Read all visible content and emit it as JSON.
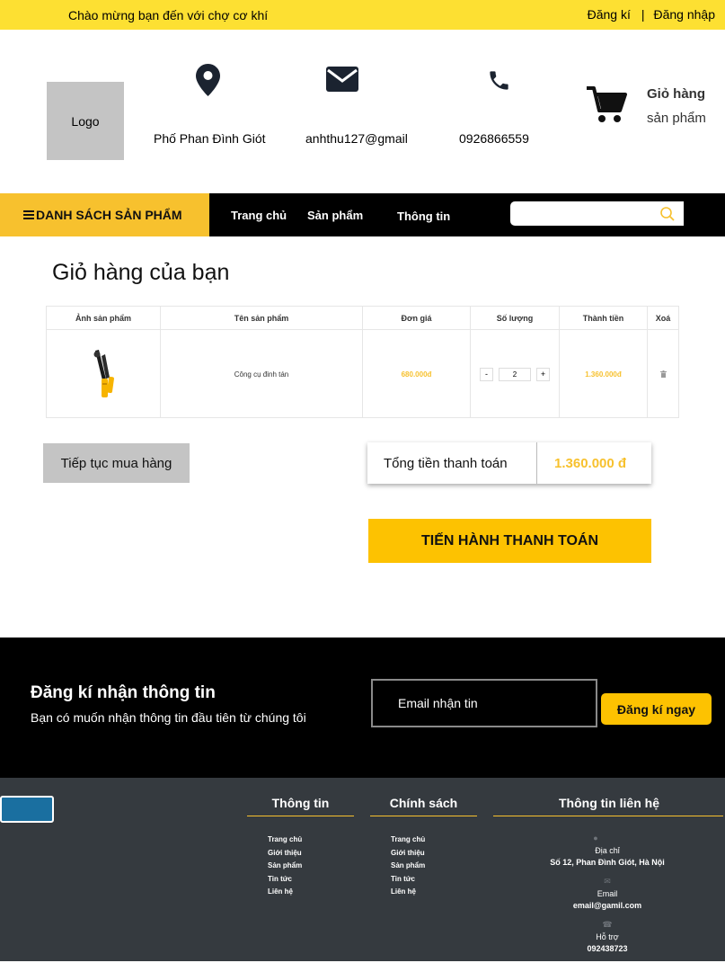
{
  "topbar": {
    "welcome": "Chào mừng bạn đến với chợ cơ khí",
    "register": "Đăng kí",
    "separator": "|",
    "login": "Đăng nhập"
  },
  "header": {
    "logo": "Logo",
    "address": "Phố Phan Đình Giót",
    "email": "anhthu127@gmail",
    "phone": "0926866559",
    "cart_title": "Giỏ hàng",
    "cart_sub": "sản phẩm"
  },
  "nav": {
    "categories": "DANH SÁCH SẢN PHẨM",
    "home": "Trang chủ",
    "products": "Sản phẩm",
    "info": "Thông tin",
    "search_placeholder": ""
  },
  "cart": {
    "title": "Giỏ hàng của bạn",
    "headers": {
      "image": "Ảnh sản phẩm",
      "name": "Tên sản phẩm",
      "unit_price": "Đơn giá",
      "quantity": "Số lượng",
      "subtotal": "Thành tiền",
      "remove": "Xoá"
    },
    "item": {
      "name": "Công cụ đinh tán",
      "unit_price": "680.000đ",
      "quantity": "2",
      "minus": "-",
      "plus": "+",
      "subtotal": "1.360.000đ"
    },
    "continue_label": "Tiếp tục mua hàng",
    "total_label": "Tổng tiền thanh toán",
    "total_value": "1.360.000 đ",
    "checkout_label": "TIẾN HÀNH THANH TOÁN"
  },
  "newsletter": {
    "title": "Đăng kí nhận thông tin",
    "subtitle": "Bạn có muốn nhận thông tin đầu tiên từ chúng tôi",
    "placeholder": "Email nhận tin",
    "button": "Đăng kí  ngay"
  },
  "footer": {
    "info_title": "Thông tin",
    "info_links": [
      "Trang chủ",
      "Giới thiệu",
      "Sản phẩm",
      "Tin tức",
      "Liên hệ"
    ],
    "policy_title": "Chính sách",
    "policy_links": [
      "Trang chủ",
      "Giới thiệu",
      "Sản phẩm",
      "Tin tức",
      "Liên hệ"
    ],
    "contact_title": "Thông tin liên hệ",
    "address_label": "Địa chỉ",
    "address_value": "Số 12, Phan Đình Giót, Hà Nội",
    "email_label": "Email",
    "email_value": "email@gamil.com",
    "support_label": "Hỗ trợ",
    "support_value": "092438723"
  },
  "colors": {
    "topbar": "#fde032",
    "accent": "#f7c12e",
    "button_yellow": "#fdc201",
    "nav_bg": "#000000",
    "footer_bg": "#353a3f"
  },
  "icons": [
    "map-pin-icon",
    "envelope-icon",
    "phone-icon",
    "cart-icon",
    "menu-icon",
    "search-icon",
    "trash-icon"
  ]
}
